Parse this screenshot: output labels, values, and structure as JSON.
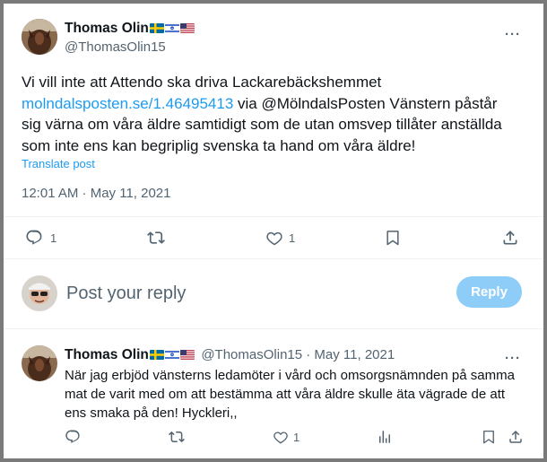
{
  "main_tweet": {
    "author_name": "Thomas Olin",
    "flags": [
      "sweden-flag",
      "israel-flag",
      "usa-flag"
    ],
    "handle": "@ThomasOlin15",
    "text_line1": "Vi vill inte att Attendo ska driva Lackarebäckshemmet",
    "link": "molndalsposten.se/1.46495413",
    "text_after_link": " via @MölndalsPosten Vänstern påstår",
    "text_line3": "sig värna om våra äldre samtidigt som de utan omsvep tillåter anställda",
    "text_line4": "som inte ens kan begriplig svenska ta hand om våra äldre!",
    "translate": "Translate post",
    "timestamp": "12:01 AM · May 11, 2021",
    "reply_count": "1",
    "like_count": "1"
  },
  "reply_box": {
    "placeholder": "Post your reply",
    "button_label": "Reply"
  },
  "reply_tweet": {
    "author_name": "Thomas Olin",
    "handle_and_time": "@ThomasOlin15 · May 11, 2021",
    "line1": "När jag erbjöd vänsterns ledamöter i vård och omsorgsnämnden på samma",
    "line2": "mat de varit med om att bestämma att våra äldre skulle äta vägrade de att",
    "line3": "ens smaka på den! Hyckleri,,",
    "like_count": "1"
  },
  "colors": {
    "accent": "#1d9bf0",
    "reply_button_disabled": "#8ecdf8",
    "muted": "#536471"
  }
}
